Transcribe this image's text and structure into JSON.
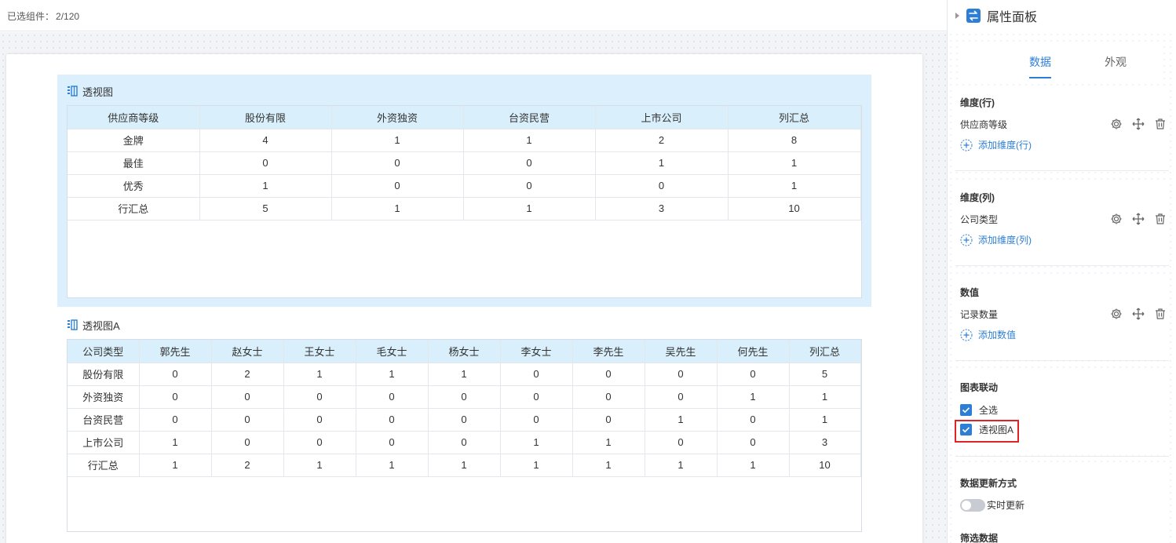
{
  "topbar": {
    "selected_label": "已选组件：",
    "selected_count": "2/120"
  },
  "pivot1": {
    "title": "透视图",
    "headers": [
      "供应商等级",
      "股份有限",
      "外资独资",
      "台资民营",
      "上市公司",
      "列汇总"
    ],
    "rows": [
      [
        "金牌",
        "4",
        "1",
        "1",
        "2",
        "8"
      ],
      [
        "最佳",
        "0",
        "0",
        "0",
        "1",
        "1"
      ],
      [
        "优秀",
        "1",
        "0",
        "0",
        "0",
        "1"
      ],
      [
        "行汇总",
        "5",
        "1",
        "1",
        "3",
        "10"
      ]
    ]
  },
  "pivot2": {
    "title": "透视图A",
    "headers": [
      "公司类型",
      "郭先生",
      "赵女士",
      "王女士",
      "毛女士",
      "杨女士",
      "李女士",
      "李先生",
      "吴先生",
      "何先生",
      "列汇总"
    ],
    "rows": [
      [
        "股份有限",
        "0",
        "2",
        "1",
        "1",
        "1",
        "0",
        "0",
        "0",
        "0",
        "5"
      ],
      [
        "外资独资",
        "0",
        "0",
        "0",
        "0",
        "0",
        "0",
        "0",
        "0",
        "1",
        "1"
      ],
      [
        "台资民营",
        "0",
        "0",
        "0",
        "0",
        "0",
        "0",
        "0",
        "1",
        "0",
        "1"
      ],
      [
        "上市公司",
        "1",
        "0",
        "0",
        "0",
        "0",
        "1",
        "1",
        "0",
        "0",
        "3"
      ],
      [
        "行汇总",
        "1",
        "2",
        "1",
        "1",
        "1",
        "1",
        "1",
        "1",
        "1",
        "10"
      ]
    ]
  },
  "panel": {
    "title": "属性面板",
    "tabs": [
      "数据",
      "外观"
    ],
    "rows_dim": {
      "title": "维度(行)",
      "field": "供应商等级",
      "add": "添加维度(行)"
    },
    "cols_dim": {
      "title": "维度(列)",
      "field": "公司类型",
      "add": "添加维度(列)"
    },
    "values": {
      "title": "数值",
      "field": "记录数量",
      "add": "添加数值"
    },
    "linkage": {
      "title": "图表联动",
      "select_all": "全选",
      "item": "透视图A"
    },
    "update": {
      "title": "数据更新方式",
      "toggle": "实时更新"
    },
    "filter": {
      "title": "筛选数据"
    }
  },
  "colors": {
    "accent": "#2d7fd6",
    "header_bg": "#d9effb",
    "selected_bg": "#dbeffd",
    "highlight": "#e02424"
  },
  "icons": [
    "pivot-table-icon",
    "swap-icon",
    "gear-icon",
    "move-icon",
    "trash-icon",
    "plus-circle-icon",
    "check-icon",
    "caret-right-icon"
  ]
}
